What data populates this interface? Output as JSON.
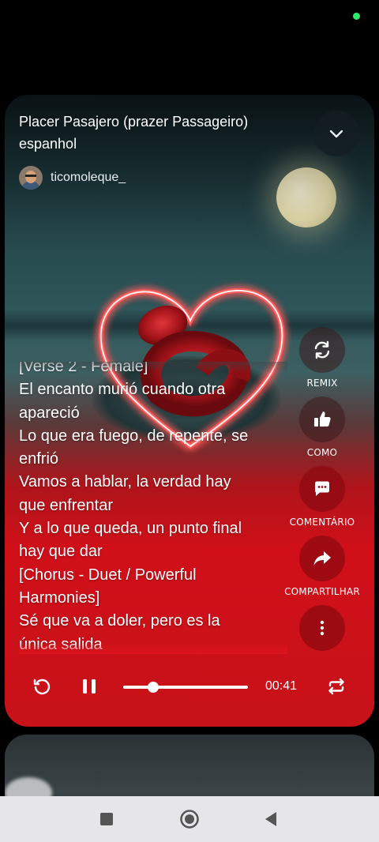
{
  "song": {
    "title": "Placer Pasajero (prazer Passageiro) espanhol",
    "author": "ticomoleque_"
  },
  "lyrics": [
    "[Verse 2 - Female]",
    "El encanto murió cuando otra",
    "apareció",
    "Lo que era fuego, de repente, se",
    "enfrió",
    "Vamos a hablar, la verdad hay",
    "que enfrentar",
    "Y a lo que queda, un punto final",
    "hay que dar",
    "[Chorus - Duet / Powerful",
    "Harmonies]",
    "Sé que va a doler, pero es la",
    "única salida"
  ],
  "actions": {
    "remix": {
      "label": "REMIX",
      "icon": "remix-icon"
    },
    "like": {
      "label": "COMO",
      "icon": "thumbs-up-icon"
    },
    "comment": {
      "label": "COMENTÁRIO",
      "icon": "comment-icon"
    },
    "share": {
      "label": "COMPARTILHAR",
      "icon": "share-icon"
    },
    "more": {
      "icon": "more-vertical-icon"
    }
  },
  "player": {
    "time": "00:41",
    "progress": 0.24,
    "state": "playing"
  },
  "colors": {
    "accent_red": "#e2141c",
    "status_green": "#2ee86a"
  }
}
